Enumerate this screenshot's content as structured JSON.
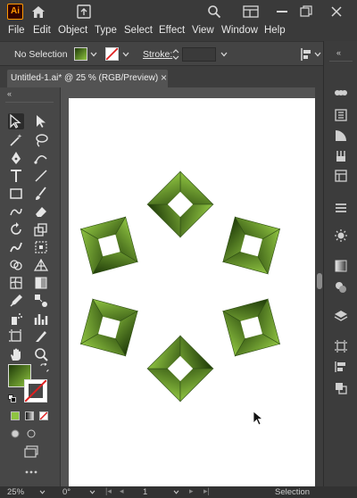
{
  "app": {
    "logo_text": "Ai",
    "accent": "#ff9a00"
  },
  "menu": [
    "File",
    "Edit",
    "Object",
    "Type",
    "Select",
    "Effect",
    "View",
    "Window",
    "Help"
  ],
  "control_bar": {
    "selection_label": "No Selection",
    "stroke_label": "Stroke:"
  },
  "document_tab": {
    "title": "Untitled-1.ai* @ 25 % (RGB/Preview)",
    "close": "×"
  },
  "status": {
    "zoom": "25%",
    "rotation": "0°",
    "artboard_number": "1",
    "tool": "Selection"
  },
  "colors": {
    "fill_dark": "#1e3a08",
    "fill_light": "#8fc441",
    "ui_dark": "#3a3a3a",
    "artboard": "#ffffff"
  },
  "artwork": {
    "description_icon": "green-rotated-square-rosette"
  }
}
